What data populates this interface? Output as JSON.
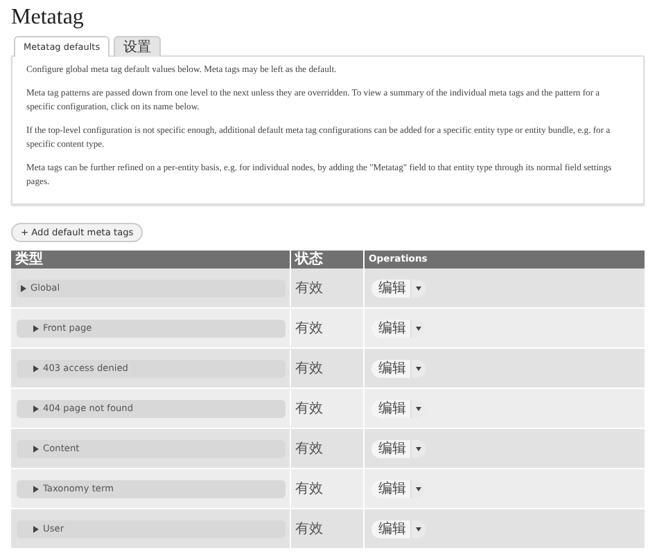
{
  "title": "Metatag",
  "tabs": [
    {
      "label": "Metatag defaults",
      "selected": true
    },
    {
      "label": "设置",
      "selected": false
    }
  ],
  "description": [
    "Configure global meta tag default values below. Meta tags may be left as the default.",
    "Meta tag patterns are passed down from one level to the next unless they are overridden. To view a summary of the individual meta tags and the pattern for a specific configuration, click on its name below.",
    "If the top-level configuration is not specific enough, additional default meta tag configurations can be added for a specific entity type or entity bundle, e.g. for a specific content type.",
    "Meta tags can be further refined on a per-entity basis, e.g. for individual nodes, by adding the \"Metatag\" field to that entity type through its normal field settings pages."
  ],
  "add_button": "+ Add default meta tags",
  "table": {
    "columns": [
      "类型",
      "状态",
      "Operations"
    ],
    "rows": [
      {
        "name": "Global",
        "status": "有效",
        "operation": "编辑",
        "children": [
          {
            "name": "Front page",
            "status": "有效",
            "operation": "编辑"
          },
          {
            "name": "403 access denied",
            "status": "有效",
            "operation": "编辑"
          },
          {
            "name": "404 page not found",
            "status": "有效",
            "operation": "编辑"
          },
          {
            "name": "Content",
            "status": "有效",
            "operation": "编辑"
          },
          {
            "name": "Taxonomy term",
            "status": "有效",
            "operation": "编辑"
          },
          {
            "name": "User",
            "status": "有效",
            "operation": "编辑"
          }
        ]
      }
    ]
  }
}
